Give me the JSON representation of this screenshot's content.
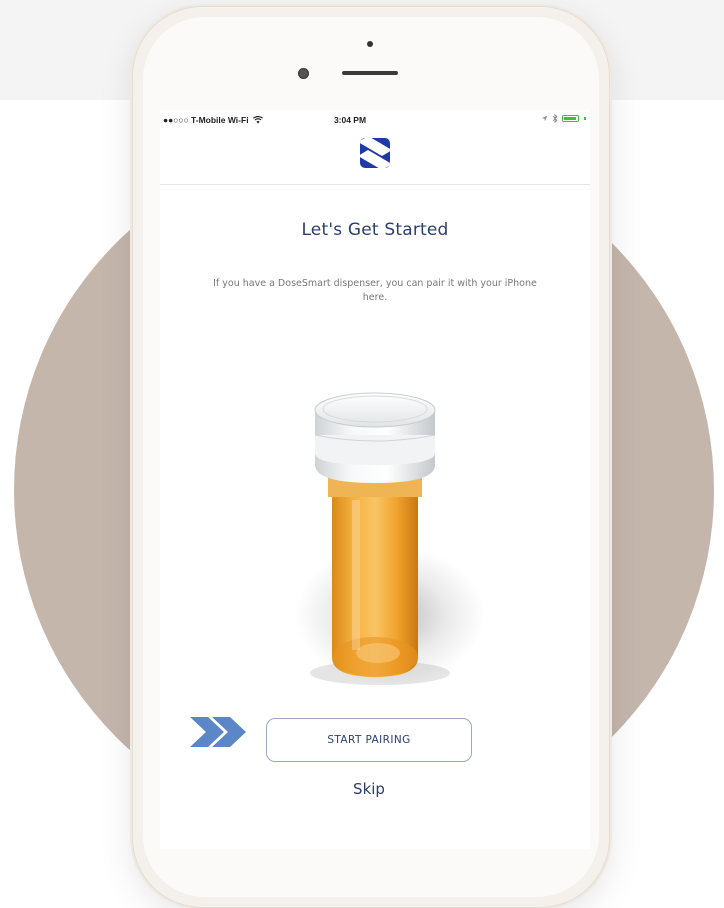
{
  "status_bar": {
    "carrier": "●●○○○ T-Mobile Wi-Fi",
    "time": "3:04 PM",
    "battery_level": 0.9
  },
  "header": {
    "logo": "dosesmart-s-logo"
  },
  "main": {
    "title": "Let's Get Started",
    "description": "If you have a DoseSmart dispenser, you can pair it with your iPhone here.",
    "image": "pill-bottle-dispenser",
    "primary_button": "START PAIRING",
    "secondary_link": "Skip"
  },
  "colors": {
    "accent": "#2c3e70",
    "logo_blue": "#1f3aa8",
    "arrow_blue": "#5b86c8",
    "button_border": "#9aaac3",
    "circle_bg": "#c5b6ac"
  },
  "icons": {
    "arrows": "double-chevron-right-icon",
    "wifi": "wifi-icon",
    "location": "location-arrow-icon",
    "bluetooth": "bluetooth-icon",
    "battery": "battery-icon"
  }
}
